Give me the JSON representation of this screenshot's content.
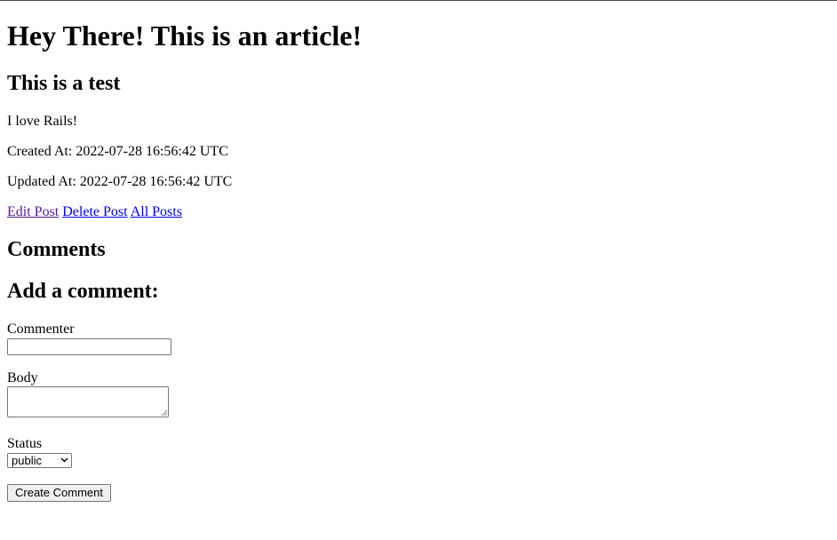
{
  "article": {
    "title": "Hey There! This is an article!",
    "subtitle": "This is a test",
    "body": "I love Rails!",
    "created_at": "Created At: 2022-07-28 16:56:42 UTC",
    "updated_at": "Updated At: 2022-07-28 16:56:42 UTC"
  },
  "actions": {
    "edit_label": "Edit Post",
    "delete_label": "Delete Post",
    "all_label": "All Posts"
  },
  "comments": {
    "heading": "Comments",
    "form_heading": "Add a comment:",
    "commenter_label": "Commenter",
    "commenter_value": "",
    "body_label": "Body",
    "body_value": "",
    "status_label": "Status",
    "status_value": "public",
    "submit_label": "Create Comment"
  },
  "icons": {
    "select_chevron": "chevron-down-icon",
    "textarea_grip": "resize-grip-icon"
  },
  "colors": {
    "link": "#0000ee",
    "visited_link": "#551a8b",
    "border": "#767676",
    "button_bg": "#efefef"
  }
}
